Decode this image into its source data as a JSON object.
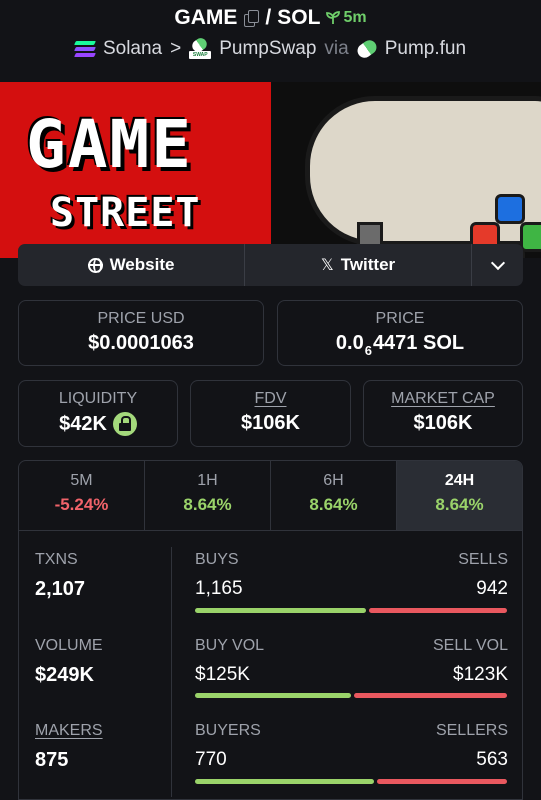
{
  "header": {
    "base_token": "GAME",
    "separator": "/",
    "quote_token": "SOL",
    "age": "5m",
    "chain": "Solana",
    "chevron": ">",
    "dex": "PumpSwap",
    "dex_icon_tag": "SWAP",
    "via": "via",
    "launchpad": "Pump.fun"
  },
  "banner": {
    "line1": "GAME",
    "line2": "STREET"
  },
  "links": {
    "website": "Website",
    "twitter": "Twitter",
    "twitter_icon": "𝕏"
  },
  "price": {
    "usd_label": "PRICE USD",
    "usd_value": "$0.0001063",
    "native_label": "PRICE",
    "native_prefix": "0.0",
    "native_zero_count": "6",
    "native_digits": "4471 SOL"
  },
  "metrics": {
    "liquidity_label": "LIQUIDITY",
    "liquidity_value": "$42K",
    "fdv_label": "FDV",
    "fdv_value": "$106K",
    "mcap_label": "MARKET CAP",
    "mcap_value": "$106K"
  },
  "timeframes": [
    {
      "label": "5M",
      "change": "-5.24%",
      "trend": "negative"
    },
    {
      "label": "1H",
      "change": "8.64%",
      "trend": "positive"
    },
    {
      "label": "6H",
      "change": "8.64%",
      "trend": "positive"
    },
    {
      "label": "24H",
      "change": "8.64%",
      "trend": "positive",
      "selected": true
    }
  ],
  "stats": {
    "txns_label": "TXNS",
    "txns_value": "2,107",
    "buys_label": "BUYS",
    "buys_value": "1,165",
    "sells_label": "SELLS",
    "sells_value": "942",
    "buy_share": 0.553,
    "volume_label": "VOLUME",
    "volume_value": "$249K",
    "buyvol_label": "BUY VOL",
    "buyvol_value": "$125K",
    "sellvol_label": "SELL VOL",
    "sellvol_value": "$123K",
    "buyvol_share": 0.504,
    "makers_label": "MAKERS",
    "makers_value": "875",
    "buyers_label": "BUYERS",
    "buyers_value": "770",
    "sellers_label": "SELLERS",
    "sellers_value": "563",
    "buyers_share": 0.578
  },
  "colors": {
    "positive": "#9ad36a",
    "negative": "#f0636a",
    "age": "#6fce6a",
    "background": "#121317"
  }
}
